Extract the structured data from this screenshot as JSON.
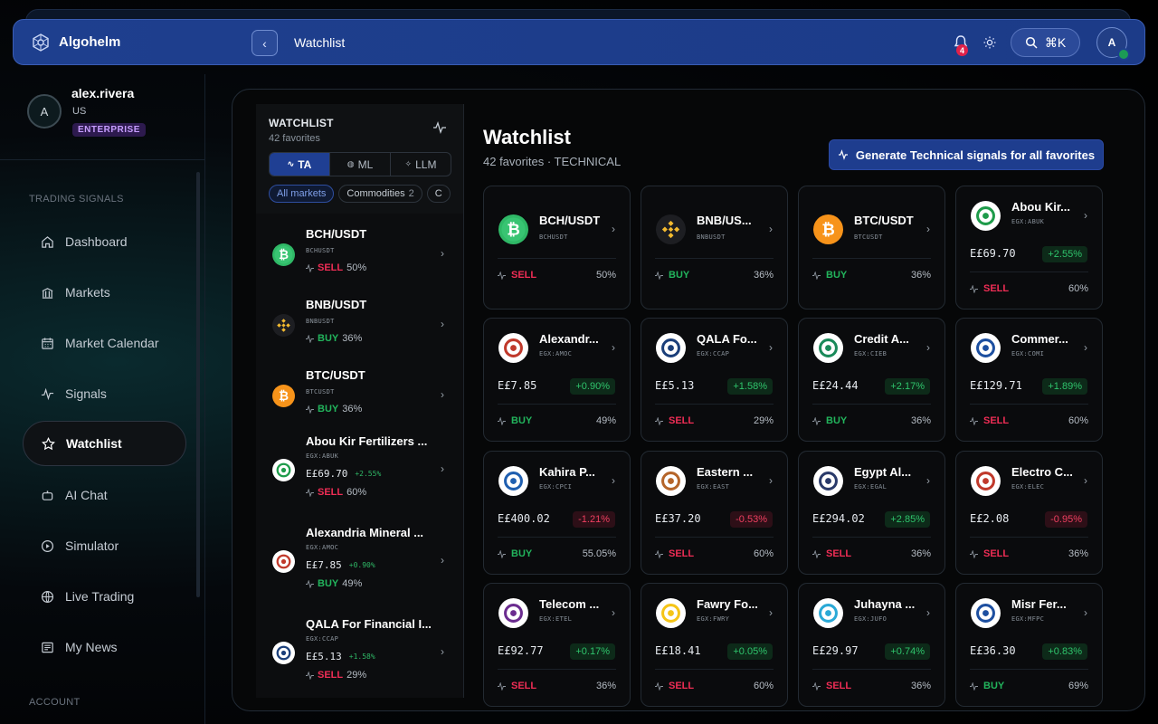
{
  "topbar": {
    "brand": "Algohelm",
    "breadcrumb": "Watchlist",
    "notif_count": "4",
    "shortcut": "⌘K",
    "avatar": "A"
  },
  "user": {
    "initial": "A",
    "name": "alex.rivera",
    "region": "US",
    "plan": "ENTERPRISE"
  },
  "sidebar": {
    "section_trading": "TRADING SIGNALS",
    "section_account": "ACCOUNT",
    "items": [
      {
        "label": "Dashboard",
        "icon": "home-icon"
      },
      {
        "label": "Markets",
        "icon": "bank-icon"
      },
      {
        "label": "Market Calendar",
        "icon": "calendar-icon"
      },
      {
        "label": "Signals",
        "icon": "pulse-icon"
      },
      {
        "label": "Watchlist",
        "icon": "star-icon",
        "active": true
      },
      {
        "label": "AI Chat",
        "icon": "bot-icon"
      },
      {
        "label": "Simulator",
        "icon": "play-circle-icon"
      },
      {
        "label": "Live Trading",
        "icon": "globe-icon"
      },
      {
        "label": "My News",
        "icon": "newspaper-icon"
      }
    ]
  },
  "watchlist": {
    "title": "WATCHLIST",
    "subtitle": "42 favorites",
    "tabs": [
      "TA",
      "ML",
      "LLM"
    ],
    "chips": [
      {
        "label": "All markets",
        "count": ""
      },
      {
        "label": "Commodities",
        "count": "2"
      },
      {
        "label": "C",
        "count": ""
      }
    ],
    "items": [
      {
        "name": "BCH/USDT",
        "ticker": "BCHUSDT",
        "price": "",
        "change": "",
        "signal": "SELL",
        "pct": "50%"
      },
      {
        "name": "BNB/USDT",
        "ticker": "BNBUSDT",
        "price": "",
        "change": "",
        "signal": "BUY",
        "pct": "36%"
      },
      {
        "name": "BTC/USDT",
        "ticker": "BTCUSDT",
        "price": "",
        "change": "",
        "signal": "BUY",
        "pct": "36%"
      },
      {
        "name": "Abou Kir Fertilizers ...",
        "ticker": "EGX:ABUK",
        "price": "E£69.70",
        "change": "+2.55%",
        "signal": "SELL",
        "pct": "60%"
      },
      {
        "name": "Alexandria Mineral ...",
        "ticker": "EGX:AMOC",
        "price": "E£7.85",
        "change": "+0.90%",
        "signal": "BUY",
        "pct": "49%"
      },
      {
        "name": "QALA For Financial I...",
        "ticker": "EGX:CCAP",
        "price": "E£5.13",
        "change": "+1.58%",
        "signal": "SELL",
        "pct": "29%"
      }
    ]
  },
  "content": {
    "title": "Watchlist",
    "subtitle": "42 favorites · TECHNICAL",
    "generate_label": "Generate Technical signals for all favorites",
    "cards": [
      {
        "name": "BCH/USDT",
        "ticker": "BCHUSDT",
        "price": "",
        "change": "",
        "dir": "",
        "signal": "SELL",
        "pct": "50%",
        "color": "#2fb866"
      },
      {
        "name": "BNB/US...",
        "ticker": "BNBUSDT",
        "price": "",
        "change": "",
        "dir": "",
        "signal": "BUY",
        "pct": "36%",
        "color": "#f3ba2f"
      },
      {
        "name": "BTC/USDT",
        "ticker": "BTCUSDT",
        "price": "",
        "change": "",
        "dir": "",
        "signal": "BUY",
        "pct": "36%",
        "color": "#f7931a"
      },
      {
        "name": "Abou Kir...",
        "ticker": "EGX:ABUK",
        "price": "E£69.70",
        "change": "+2.55%",
        "dir": "up",
        "signal": "SELL",
        "pct": "60%",
        "color": "#1e9b4a"
      },
      {
        "name": "Alexandr...",
        "ticker": "EGX:AMOC",
        "price": "E£7.85",
        "change": "+0.90%",
        "dir": "up",
        "signal": "BUY",
        "pct": "49%",
        "color": "#c0392b"
      },
      {
        "name": "QALA Fo...",
        "ticker": "EGX:CCAP",
        "price": "E£5.13",
        "change": "+1.58%",
        "dir": "up",
        "signal": "SELL",
        "pct": "29%",
        "color": "#1b3f7a"
      },
      {
        "name": "Credit A...",
        "ticker": "EGX:CIEB",
        "price": "E£24.44",
        "change": "+2.17%",
        "dir": "up",
        "signal": "BUY",
        "pct": "36%",
        "color": "#1a8a5a"
      },
      {
        "name": "Commer...",
        "ticker": "EGX:COMI",
        "price": "E£129.71",
        "change": "+1.89%",
        "dir": "up",
        "signal": "SELL",
        "pct": "60%",
        "color": "#1c4fa0"
      },
      {
        "name": "Kahira P...",
        "ticker": "EGX:CPCI",
        "price": "E£400.02",
        "change": "-1.21%",
        "dir": "dn",
        "signal": "BUY",
        "pct": "55.05%",
        "color": "#1f5fb0"
      },
      {
        "name": "Eastern ...",
        "ticker": "EGX:EAST",
        "price": "E£37.20",
        "change": "-0.53%",
        "dir": "dn",
        "signal": "SELL",
        "pct": "60%",
        "color": "#b5652a"
      },
      {
        "name": "Egypt Al...",
        "ticker": "EGX:EGAL",
        "price": "E£294.02",
        "change": "+2.85%",
        "dir": "up",
        "signal": "SELL",
        "pct": "36%",
        "color": "#2a3a6a"
      },
      {
        "name": "Electro C...",
        "ticker": "EGX:ELEC",
        "price": "E£2.08",
        "change": "-0.95%",
        "dir": "dn",
        "signal": "SELL",
        "pct": "36%",
        "color": "#c0392b"
      },
      {
        "name": "Telecom ...",
        "ticker": "EGX:ETEL",
        "price": "E£92.77",
        "change": "+0.17%",
        "dir": "up",
        "signal": "SELL",
        "pct": "36%",
        "color": "#6b2c8f"
      },
      {
        "name": "Fawry Fo...",
        "ticker": "EGX:FWRY",
        "price": "E£18.41",
        "change": "+0.05%",
        "dir": "up",
        "signal": "SELL",
        "pct": "60%",
        "color": "#f5c518"
      },
      {
        "name": "Juhayna ...",
        "ticker": "EGX:JUFO",
        "price": "E£29.97",
        "change": "+0.74%",
        "dir": "up",
        "signal": "SELL",
        "pct": "36%",
        "color": "#2aa9d6"
      },
      {
        "name": "Misr Fer...",
        "ticker": "EGX:MFPC",
        "price": "E£36.30",
        "change": "+0.83%",
        "dir": "up",
        "signal": "BUY",
        "pct": "69%",
        "color": "#1d4fa0"
      }
    ]
  },
  "colors": {
    "accent": "#1e3d8e",
    "sell": "#ef2d55",
    "buy": "#22b45c",
    "up": "#2fc46c",
    "down": "#ef3f60"
  }
}
